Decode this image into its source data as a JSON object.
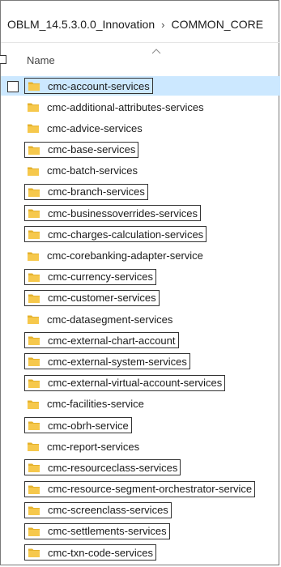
{
  "breadcrumb": {
    "root": "OBLM_14.5.3.0.0_Innovation",
    "separator": "›",
    "current": "COMMON_CORE"
  },
  "header": {
    "name_label": "Name"
  },
  "colors": {
    "folder": "#f6c84c",
    "folder_dark": "#e4b22d",
    "selection": "#cce8ff"
  },
  "folders": [
    {
      "name": "cmc-account-services",
      "boxed": true,
      "selected": true
    },
    {
      "name": "cmc-additional-attributes-services",
      "boxed": false,
      "selected": false
    },
    {
      "name": "cmc-advice-services",
      "boxed": false,
      "selected": false
    },
    {
      "name": "cmc-base-services",
      "boxed": true,
      "selected": false
    },
    {
      "name": "cmc-batch-services",
      "boxed": false,
      "selected": false
    },
    {
      "name": "cmc-branch-services",
      "boxed": true,
      "selected": false
    },
    {
      "name": "cmc-businessoverrides-services",
      "boxed": true,
      "selected": false
    },
    {
      "name": "cmc-charges-calculation-services",
      "boxed": true,
      "selected": false
    },
    {
      "name": "cmc-corebanking-adapter-service",
      "boxed": false,
      "selected": false
    },
    {
      "name": "cmc-currency-services",
      "boxed": true,
      "selected": false
    },
    {
      "name": "cmc-customer-services",
      "boxed": true,
      "selected": false
    },
    {
      "name": "cmc-datasegment-services",
      "boxed": false,
      "selected": false
    },
    {
      "name": "cmc-external-chart-account",
      "boxed": true,
      "selected": false
    },
    {
      "name": "cmc-external-system-services",
      "boxed": true,
      "selected": false
    },
    {
      "name": "cmc-external-virtual-account-services",
      "boxed": true,
      "selected": false
    },
    {
      "name": "cmc-facilities-service",
      "boxed": false,
      "selected": false
    },
    {
      "name": "cmc-obrh-service",
      "boxed": true,
      "selected": false
    },
    {
      "name": "cmc-report-services",
      "boxed": false,
      "selected": false
    },
    {
      "name": "cmc-resourceclass-services",
      "boxed": true,
      "selected": false
    },
    {
      "name": "cmc-resource-segment-orchestrator-service",
      "boxed": true,
      "selected": false
    },
    {
      "name": "cmc-screenclass-services",
      "boxed": true,
      "selected": false
    },
    {
      "name": "cmc-settlements-services",
      "boxed": true,
      "selected": false
    },
    {
      "name": "cmc-txn-code-services",
      "boxed": true,
      "selected": false
    }
  ]
}
